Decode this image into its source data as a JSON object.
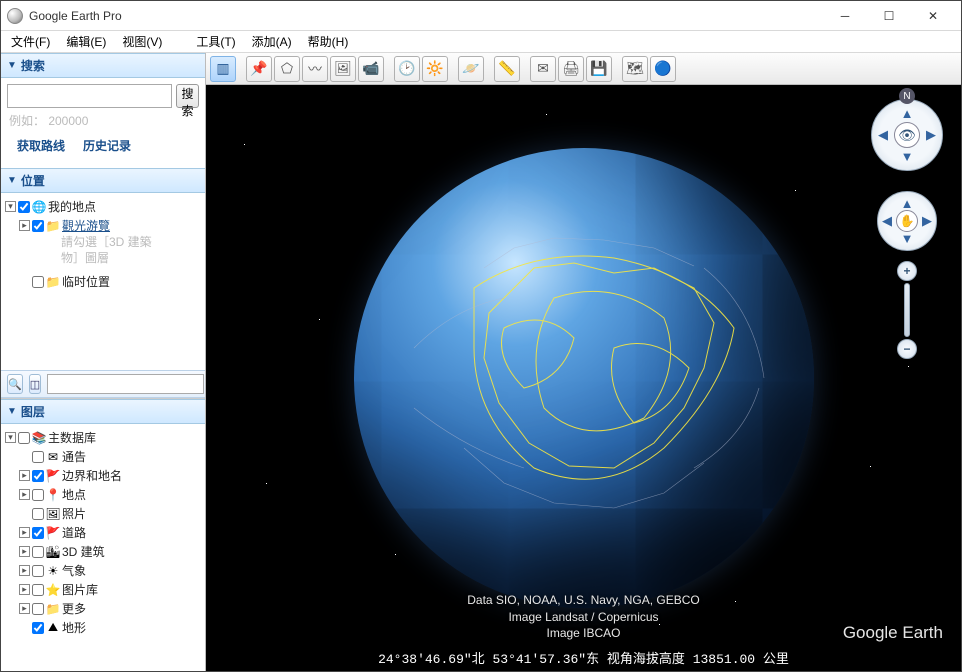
{
  "window": {
    "title": "Google Earth Pro"
  },
  "menu": {
    "file": "文件(F)",
    "edit": "编辑(E)",
    "view": "视图(V)",
    "tools": "工具(T)",
    "add": "添加(A)",
    "help": "帮助(H)"
  },
  "search": {
    "header": "搜索",
    "button": "搜索",
    "placeholder": "",
    "hint": "例如： 200000",
    "link_route": "获取路线",
    "link_history": "历史记录"
  },
  "places": {
    "header": "位置",
    "items": {
      "my_places": "我的地点",
      "sightseeing": "觀光游覽",
      "hint_line1": "請勾選［3D 建築",
      "hint_line2": "物］圖層",
      "temp": "临时位置"
    }
  },
  "layers": {
    "header": "图层",
    "root": "主数据库",
    "announcements": "通告",
    "borders": "边界和地名",
    "places_l": "地点",
    "photos": "照片",
    "roads": "道路",
    "buildings3d": "3D 建筑",
    "weather": "气象",
    "gallery": "图片库",
    "more": "更多",
    "terrain": "地形"
  },
  "attribution": {
    "l1": "Data SIO, NOAA, U.S. Navy, NGA, GEBCO",
    "l2": "Image Landsat / Copernicus",
    "l3": "Image IBCAO"
  },
  "brand": "Google Earth",
  "status": "24°38'46.69\"北   53°41'57.36\"东  视角海拔高度 13851.00 公里",
  "compass_n": "N"
}
